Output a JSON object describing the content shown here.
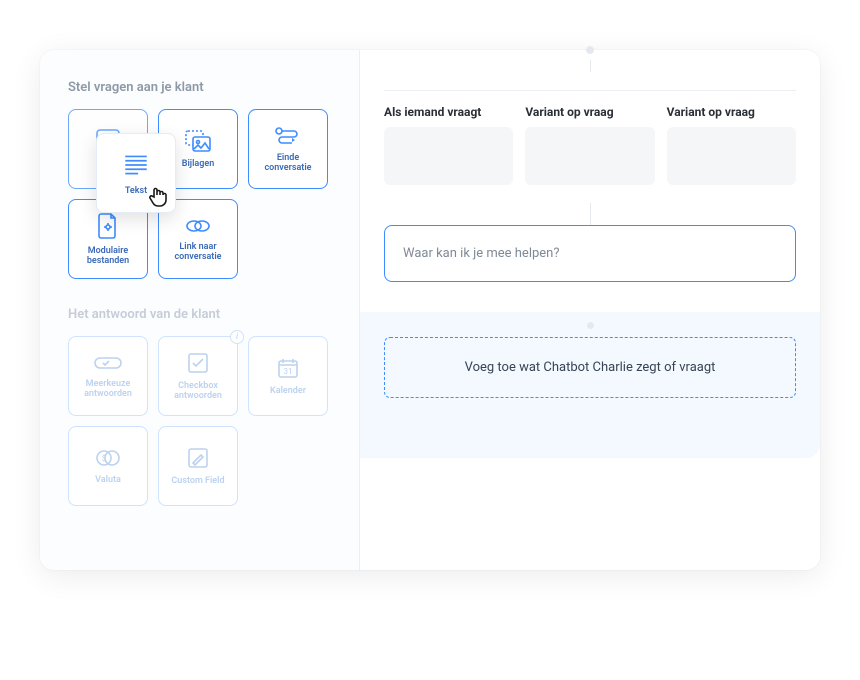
{
  "sidebar": {
    "ask_title": "Stel vragen aan je klant",
    "answer_title": "Het antwoord van de klant",
    "ask_tiles": [
      {
        "key": "tekst",
        "label": "Tekst"
      },
      {
        "key": "bijlagen",
        "label": "Bijlagen"
      },
      {
        "key": "einde",
        "label": "Einde conversatie"
      },
      {
        "key": "modulaire",
        "label": "Modulaire bestanden"
      },
      {
        "key": "link",
        "label": "Link naar conversatie"
      }
    ],
    "answer_tiles": [
      {
        "key": "meerkeuze",
        "label": "Meerkeuze antwoorden"
      },
      {
        "key": "checkbox",
        "label": "Checkbox antwoorden",
        "info": true
      },
      {
        "key": "kalender",
        "label": "Kalender"
      },
      {
        "key": "valuta",
        "label": "Valuta"
      },
      {
        "key": "custom",
        "label": "Custom Field"
      }
    ],
    "dragging": {
      "label": "Tekst"
    }
  },
  "main": {
    "variants": [
      {
        "label": "Als iemand vraagt"
      },
      {
        "label": "Variant op vraag"
      },
      {
        "label": "Variant op vraag"
      }
    ],
    "response_placeholder": "Waar kan ik je mee helpen?",
    "drop_text": "Voeg toe wat Chatbot Charlie zegt of vraagt"
  }
}
